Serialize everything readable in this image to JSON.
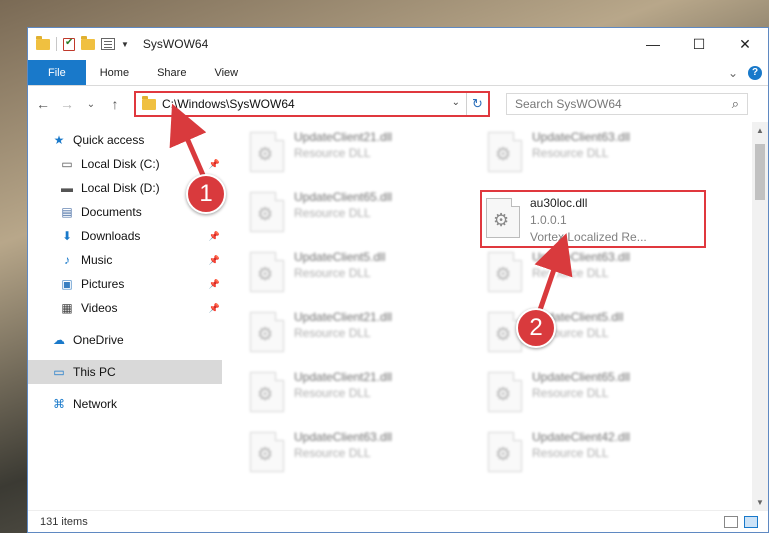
{
  "window": {
    "title": "SysWOW64",
    "minimize": "—",
    "maximize": "☐",
    "close": "✕"
  },
  "ribbon": {
    "tabs": [
      "File",
      "Home",
      "Share",
      "View"
    ],
    "expand": "⌄",
    "help": "?"
  },
  "address": {
    "back": "←",
    "forward": "→",
    "recent": "⌄",
    "up": "↑",
    "path": "C:\\Windows\\SysWOW64",
    "dropdown": "⌄",
    "refresh": "↻"
  },
  "search": {
    "placeholder": "Search SysWOW64",
    "icon": "⌕"
  },
  "nav": {
    "items": [
      {
        "label": "Quick access",
        "icon": "★",
        "icon_name": "star-icon"
      },
      {
        "label": "Local Disk (C:)",
        "icon": "▭",
        "icon_name": "drive-icon"
      },
      {
        "label": "Local Disk (D:)",
        "icon": "▬",
        "icon_name": "drive-icon"
      },
      {
        "label": "Documents",
        "icon": "▤",
        "icon_name": "documents-icon"
      },
      {
        "label": "Downloads",
        "icon": "⬇",
        "icon_name": "downloads-icon"
      },
      {
        "label": "Music",
        "icon": "♪",
        "icon_name": "music-icon"
      },
      {
        "label": "Pictures",
        "icon": "▣",
        "icon_name": "pictures-icon"
      },
      {
        "label": "Videos",
        "icon": "▦",
        "icon_name": "videos-icon"
      },
      {
        "label": "OneDrive",
        "icon": "☁",
        "icon_name": "cloud-icon"
      },
      {
        "label": "This PC",
        "icon": "▭",
        "icon_name": "computer-icon"
      },
      {
        "label": "Network",
        "icon": "⌘",
        "icon_name": "network-icon"
      }
    ]
  },
  "files": [
    {
      "name": "UpdateClient21.dll",
      "desc": "Resource DLL"
    },
    {
      "name": "UpdateClient63.dll",
      "desc": "Resource DLL"
    },
    {
      "name": "UpdateClient65.dll",
      "desc": "Resource DLL"
    },
    {
      "name": "au30loc.dll",
      "version": "1.0.0.1",
      "desc": "Vortex Localized Re..."
    },
    {
      "name": "UpdateClient5.dll",
      "desc": "Resource DLL"
    },
    {
      "name": "UpdateClient63.dll",
      "desc": "Resource DLL"
    },
    {
      "name": "UpdateClient21.dll",
      "desc": "Resource DLL"
    },
    {
      "name": "UpdateClient5.dll",
      "desc": "Resource DLL"
    },
    {
      "name": "UpdateClient21.dll",
      "desc": "Resource DLL"
    },
    {
      "name": "UpdateClient65.dll",
      "desc": "Resource DLL"
    },
    {
      "name": "UpdateClient63.dll",
      "desc": "Resource DLL"
    },
    {
      "name": "UpdateClient42.dll",
      "desc": "Resource DLL"
    }
  ],
  "status": {
    "count": "131 items"
  },
  "callouts": {
    "one": "1",
    "two": "2"
  },
  "colors": {
    "accent": "#1979ca",
    "highlight": "#e0383e",
    "badge": "#d93a3d"
  }
}
